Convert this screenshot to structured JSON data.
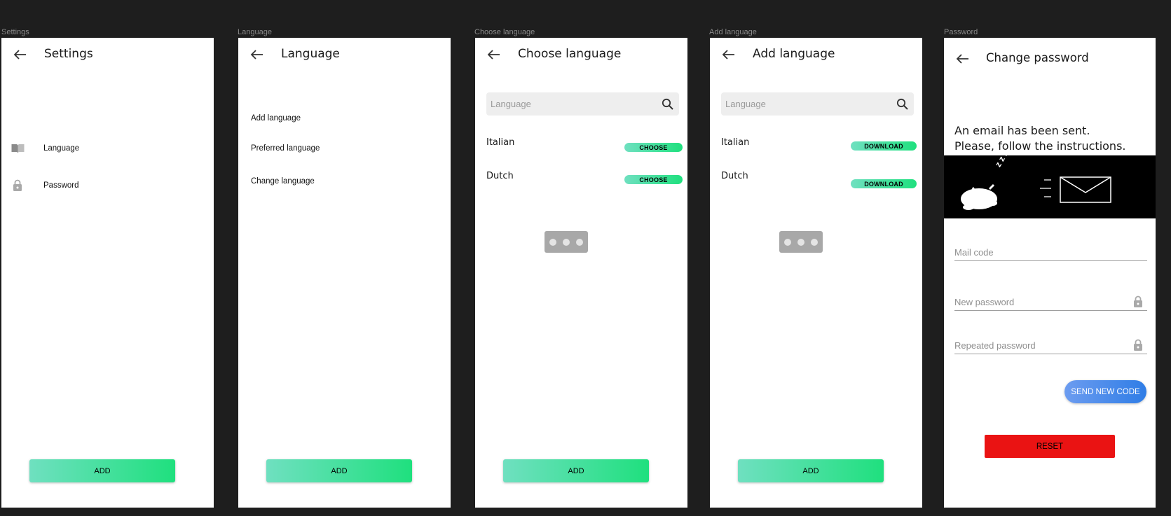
{
  "frames": {
    "settings": "Settings",
    "language": "Language",
    "choose": "Choose language",
    "add": "Add language",
    "password": "Password"
  },
  "settings": {
    "title": "Settings",
    "items": [
      {
        "label": "Language",
        "icon": "book-icon"
      },
      {
        "label": "Password",
        "icon": "lock-icon"
      }
    ],
    "add_label": "ADD"
  },
  "language": {
    "title": "Language",
    "items": [
      "Add language",
      "Preferred language",
      "Change language"
    ],
    "add_label": "ADD"
  },
  "choose": {
    "title": "Choose language",
    "search_placeholder": "Language",
    "rows": [
      {
        "name": "Italian",
        "action": "CHOOSE"
      },
      {
        "name": "Dutch",
        "action": "CHOOSE"
      }
    ],
    "add_label": "ADD"
  },
  "add": {
    "title": "Add language",
    "search_placeholder": "Language",
    "rows": [
      {
        "name": "Italian",
        "action": "DOWNLOAD"
      },
      {
        "name": "Dutch",
        "action": "DOWNLOAD"
      }
    ],
    "add_label": "ADD"
  },
  "password": {
    "title": "Change password",
    "message_line1": "An email has been sent.",
    "message_line2": "Please, follow the instructions.",
    "illustration_text": "z z z",
    "mail_code_placeholder": "Mail code",
    "new_password_placeholder": "New password",
    "repeated_password_placeholder": "Repeated password",
    "send_code_label": "SEND NEW CODE",
    "reset_label": "RESET"
  },
  "colors": {
    "background": "#1e1e1e",
    "accent_green": "#1fe07e",
    "accent_green_light": "#6fe0c0",
    "send_blue": "#2f7de6",
    "reset_red": "#ea1313"
  }
}
